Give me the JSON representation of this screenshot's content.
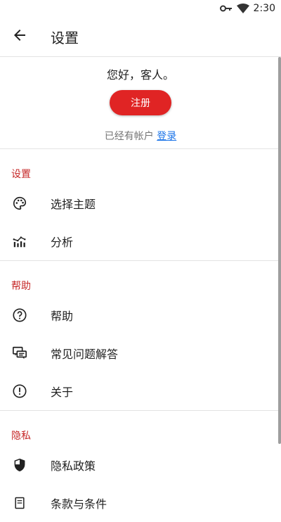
{
  "status_bar": {
    "time": "2:30",
    "icons": [
      "key-icon",
      "wifi-icon",
      "battery-icon"
    ]
  },
  "toolbar": {
    "title": "设置",
    "back_icon": "arrow-back-icon"
  },
  "account": {
    "greeting": "您好，客人。",
    "signup_label": "注册",
    "have_account": "已经有帐户",
    "login_link": "登录"
  },
  "sections": {
    "settings": {
      "header": "设置",
      "items": [
        {
          "label": "选择主题",
          "icon": "palette-icon"
        },
        {
          "label": "分析",
          "icon": "analytics-icon"
        }
      ]
    },
    "help": {
      "header": "帮助",
      "items": [
        {
          "label": "帮助",
          "icon": "help-circle-icon"
        },
        {
          "label": "常见问题解答",
          "icon": "faq-icon"
        },
        {
          "label": "关于",
          "icon": "info-icon"
        }
      ]
    },
    "privacy": {
      "header": "隐私",
      "items": [
        {
          "label": "隐私政策",
          "icon": "shield-icon"
        },
        {
          "label": "条款与条件",
          "icon": "document-icon"
        }
      ]
    }
  },
  "colors": {
    "accent": "#e02424",
    "section_header": "#c62828",
    "link": "#1a73e8"
  }
}
